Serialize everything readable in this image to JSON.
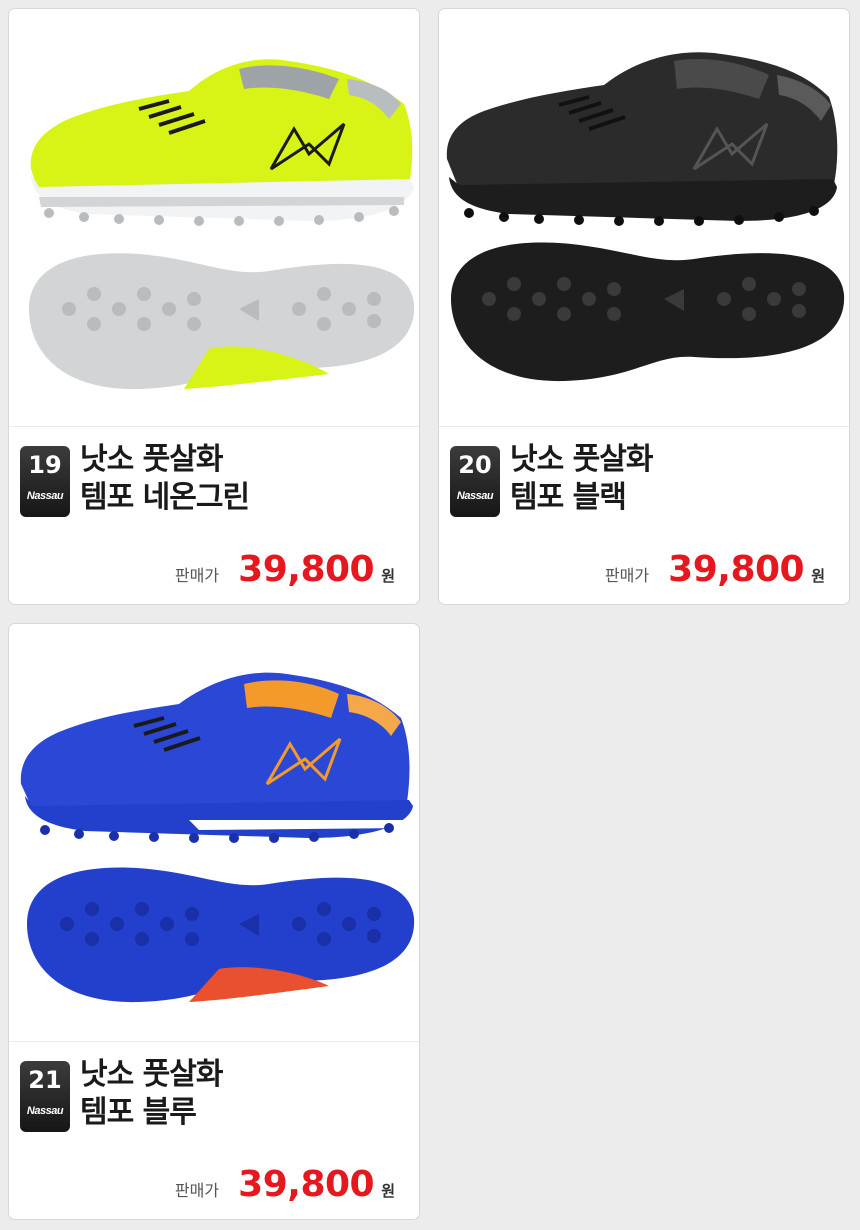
{
  "products": [
    {
      "number": "19",
      "brand": "Nassau",
      "name_line1": "낫소 풋살화",
      "name_line2": "템포 네온그린",
      "price_label": "판매가",
      "price": "39,800",
      "currency": "원",
      "colors": {
        "upper": "#d8f316",
        "accent": "#1a1a1a",
        "sole": "#d2d4d6",
        "sole_dark": "#b9bcbf",
        "collar": "#9ea3a7"
      }
    },
    {
      "number": "20",
      "brand": "Nassau",
      "name_line1": "낫소 풋살화",
      "name_line2": "템포 블랙",
      "price_label": "판매가",
      "price": "39,800",
      "currency": "원",
      "colors": {
        "upper": "#2b2b2b",
        "accent": "#555555",
        "sole": "#1d1d1d",
        "sole_dark": "#0f0f0f",
        "collar": "#4a4a4a"
      }
    },
    {
      "number": "21",
      "brand": "Nassau",
      "name_line1": "낫소 풋살화",
      "name_line2": "템포 블루",
      "price_label": "판매가",
      "price": "39,800",
      "currency": "원",
      "colors": {
        "upper": "#2a47d6",
        "accent": "#f39a2a",
        "sole": "#2340cc",
        "sole_dark": "#1a30a8",
        "collar": "#f39a2a"
      }
    }
  ]
}
